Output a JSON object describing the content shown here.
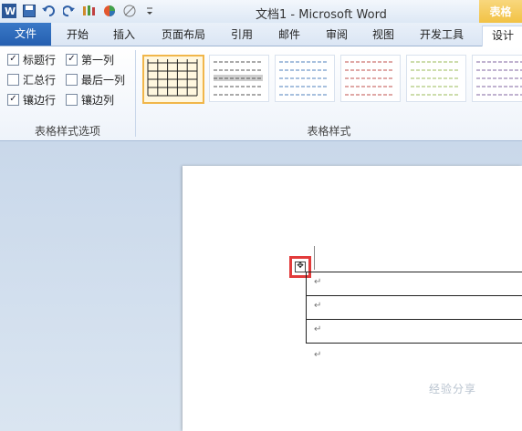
{
  "window": {
    "title": "文档1 - Microsoft Word",
    "context_tab": "表格"
  },
  "tabs": [
    "文件",
    "开始",
    "插入",
    "页面布局",
    "引用",
    "邮件",
    "审阅",
    "视图",
    "开发工具",
    "设计"
  ],
  "options": [
    {
      "label": "标题行",
      "checked": true
    },
    {
      "label": "第一列",
      "checked": true
    },
    {
      "label": "汇总行",
      "checked": false
    },
    {
      "label": "最后一列",
      "checked": false
    },
    {
      "label": "镶边行",
      "checked": true
    },
    {
      "label": "镶边列",
      "checked": false
    }
  ],
  "groups": {
    "options_label": "表格样式选项",
    "styles_label": "表格样式"
  },
  "styles": [
    {
      "name": "grid",
      "color": "#222222",
      "selected": true
    },
    {
      "name": "light-shading",
      "color": "#555555",
      "selected": false
    },
    {
      "name": "light-shading-accent1",
      "color": "#4f81bd",
      "selected": false
    },
    {
      "name": "light-shading-accent2",
      "color": "#c0504d",
      "selected": false
    },
    {
      "name": "light-shading-accent3",
      "color": "#9bbb59",
      "selected": false
    },
    {
      "name": "light-shading-accent4",
      "color": "#8064a2",
      "selected": false
    }
  ],
  "document": {
    "rows": 3,
    "paragraph_mark": "↵"
  },
  "watermark": "经验分享"
}
